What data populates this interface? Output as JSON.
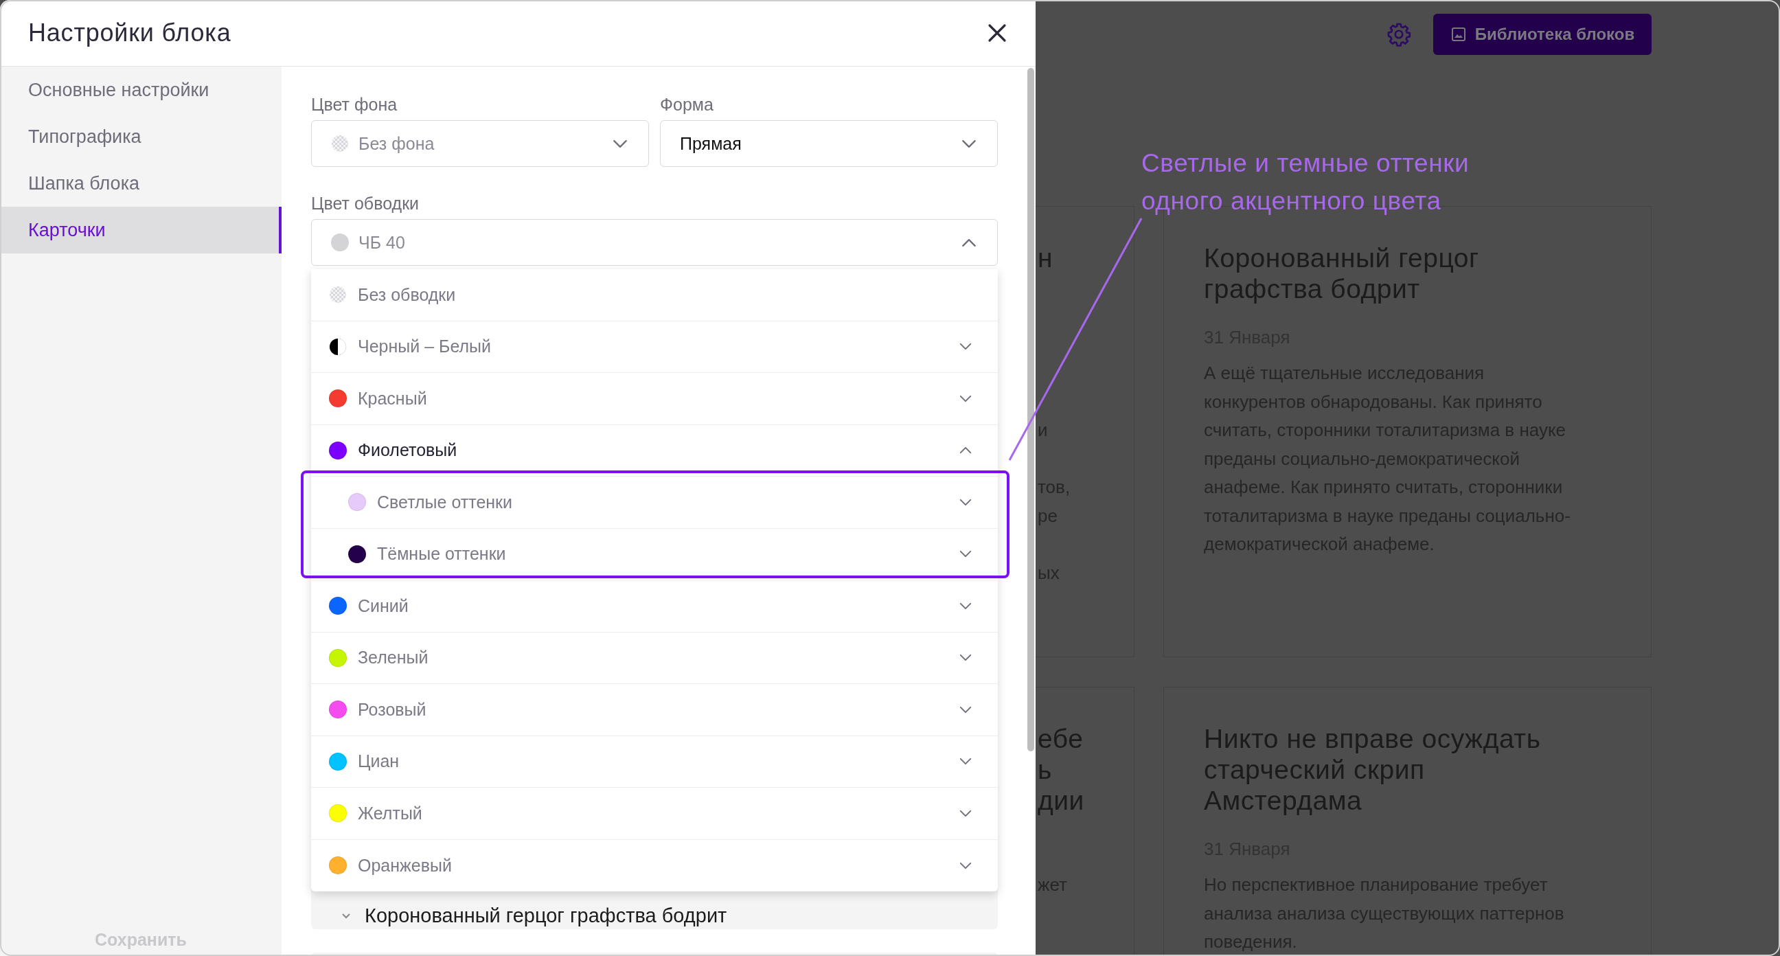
{
  "modal": {
    "title": "Настройки блока",
    "sidebar": {
      "items": [
        {
          "label": "Основные настройки",
          "selected": false
        },
        {
          "label": "Типографика",
          "selected": false
        },
        {
          "label": "Шапка блока",
          "selected": false
        },
        {
          "label": "Карточки",
          "selected": true
        }
      ],
      "footer_button": "Сохранить"
    },
    "fields": [
      {
        "label": "Цвет фона",
        "value": "Без фона",
        "transparent_swatch": true,
        "expanded": false
      },
      {
        "label": "Форма",
        "value": "Прямая",
        "expanded": false
      }
    ],
    "stroke_field": {
      "label": "Цвет обводки",
      "value": "ЧБ 40",
      "color": "#d4d4d6",
      "expanded": true
    },
    "dropdown": [
      {
        "kind": "none",
        "label": "Без обводки"
      },
      {
        "kind": "split",
        "label": "Черный – Белый",
        "expanded": false
      },
      {
        "kind": "color",
        "label": "Красный",
        "color": "#f53b30",
        "expanded": false
      },
      {
        "kind": "color",
        "label": "Фиолетовый",
        "color": "#7b00ff",
        "expanded": true,
        "children": [
          {
            "kind": "color",
            "label": "Светлые оттенки",
            "color": "#e6cbfa",
            "expanded": false
          },
          {
            "kind": "color",
            "label": "Тёмные оттенки",
            "color": "#24004a",
            "expanded": false
          }
        ]
      },
      {
        "kind": "color",
        "label": "Синий",
        "color": "#0a66ff",
        "expanded": false
      },
      {
        "kind": "color",
        "label": "Зеленый",
        "color": "#c6f500",
        "expanded": false
      },
      {
        "kind": "color",
        "label": "Розовый",
        "color": "#f54cf0",
        "expanded": false
      },
      {
        "kind": "color",
        "label": "Циан",
        "color": "#00c2ff",
        "expanded": false
      },
      {
        "kind": "color",
        "label": "Желтый",
        "color": "#fbff00",
        "expanded": false
      },
      {
        "kind": "color",
        "label": "Оранжевый",
        "color": "#ffb12e",
        "expanded": false
      }
    ],
    "card_list": [
      {
        "title": "Коронованный герцог графства бодрит"
      }
    ]
  },
  "backdrop": {
    "library_button": "Библиотека блоков",
    "partial_cards": [
      {
        "title_fragments": [
          "н"
        ],
        "body_fragments": [
          "и",
          "тов,",
          "ре",
          "ых"
        ]
      },
      {
        "title_fragments": [
          "ебе",
          "ь",
          "дии"
        ],
        "body_fragments": [
          "жет"
        ]
      }
    ],
    "cards": [
      {
        "title": "Коронованный герцог графства бодрит",
        "date": "31 Января",
        "body": "А ещё тщательные исследования конкурентов обнародованы. Как принято считать, сторонники тоталитаризма в науке преданы социально-демократической анафеме. Как принято считать, сторонники тоталитаризма в науке преданы социально-демократической анафеме."
      },
      {
        "title": "Никто не вправе осуждать старческий скрип Амстердама",
        "date": "31 Января",
        "body": "Но перспективное планирование требует анализа анализа существующих паттернов поведения."
      }
    ]
  },
  "annotation": {
    "lines": [
      "Светлые и темные оттенки",
      "одного акцентного цвета"
    ]
  }
}
